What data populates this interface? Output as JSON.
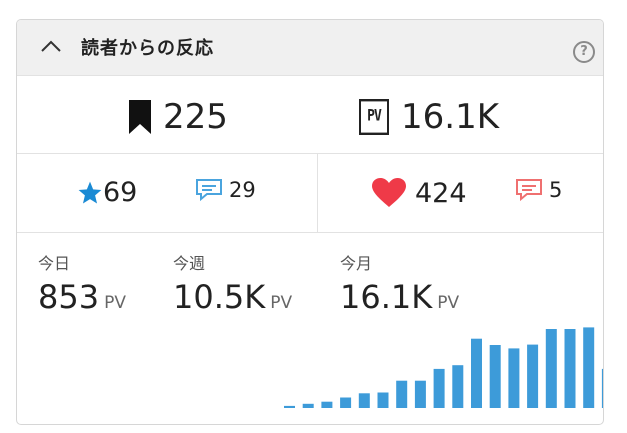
{
  "header": {
    "title": "読者からの反応",
    "help_glyph": "?"
  },
  "summary": {
    "bookmarks": "225",
    "pv_icon_label": "PV",
    "pageviews": "16.1K"
  },
  "reactions": {
    "stars": "69",
    "star_comments": "29",
    "hearts": "424",
    "heart_comments": "5"
  },
  "periods": [
    {
      "label": "今日",
      "value": "853",
      "unit": "PV"
    },
    {
      "label": "今週",
      "value": "10.5K",
      "unit": "PV"
    },
    {
      "label": "今月",
      "value": "16.1K",
      "unit": "PV"
    }
  ],
  "colors": {
    "bar": "#3d9bd9",
    "star": "#1a8ad4",
    "heart": "#ef3a48",
    "comment_blue": "#4aa4de",
    "comment_red": "#ef7070"
  },
  "chart_data": {
    "type": "bar",
    "series": [
      {
        "values": [
          0.5,
          1,
          1.5,
          2.5,
          3.5,
          3.7,
          6.5,
          6.5,
          9.3,
          10.2,
          16.5,
          15,
          14.2,
          15.1,
          18.8,
          18.8,
          19.2,
          9.3
        ]
      }
    ],
    "ylim": [
      0,
      20
    ],
    "grid": false
  }
}
